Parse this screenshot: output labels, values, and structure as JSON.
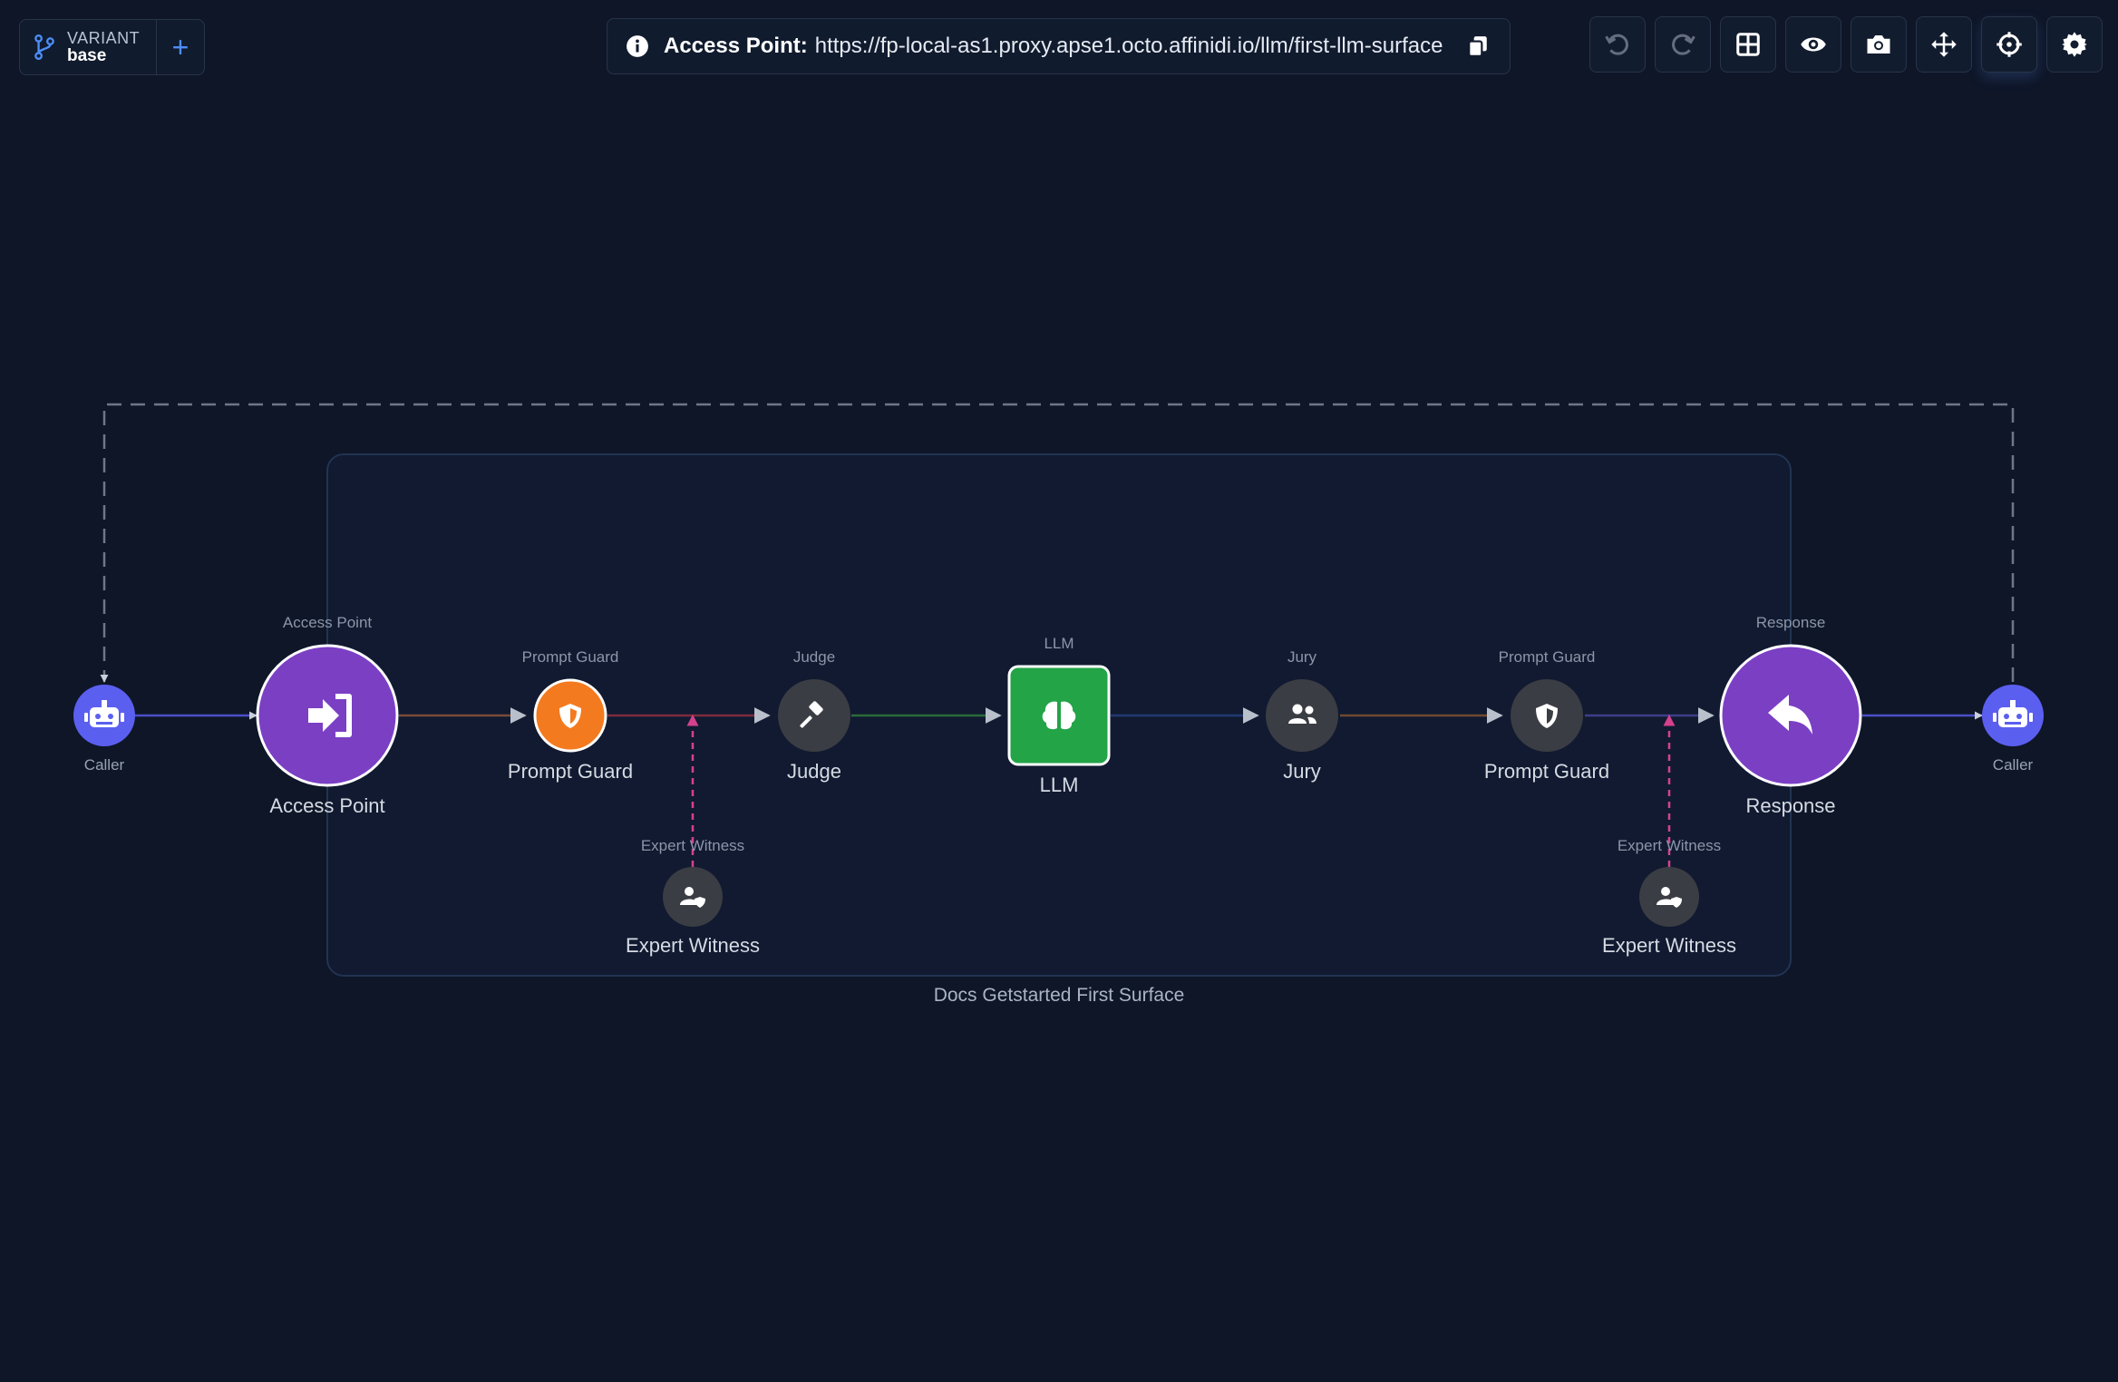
{
  "variant": {
    "label": "VARIANT",
    "value": "base",
    "add": "+"
  },
  "access": {
    "label": "Access Point:",
    "url": "https://fp-local-as1.proxy.apse1.octo.affinidi.io/llm/first-llm-surface"
  },
  "toolbar": [
    {
      "icon": "undo-icon",
      "enabled": false
    },
    {
      "icon": "redo-icon",
      "enabled": false
    },
    {
      "icon": "grid-layout-icon",
      "enabled": true
    },
    {
      "icon": "eye-icon",
      "enabled": true
    },
    {
      "icon": "camera-icon",
      "enabled": true
    },
    {
      "icon": "move-arrows-icon",
      "enabled": true
    },
    {
      "icon": "crosshair-icon",
      "enabled": true
    },
    {
      "icon": "gear-icon",
      "enabled": true
    }
  ],
  "surface": {
    "label": "Docs Getstarted First Surface"
  },
  "callers": {
    "left": "Caller",
    "right": "Caller"
  },
  "nodes": {
    "access_point": {
      "top": "Access Point",
      "label": "Access Point",
      "icon": "sign-in-icon",
      "color": "#7b3fc4"
    },
    "prompt_guard_in": {
      "top": "Prompt Guard",
      "label": "Prompt Guard",
      "icon": "shield-icon",
      "color": "#f47a1f"
    },
    "judge": {
      "top": "Judge",
      "label": "Judge",
      "icon": "gavel-icon",
      "color": "#3b3d44"
    },
    "llm": {
      "top": "LLM",
      "label": "LLM",
      "icon": "brain-icon",
      "color": "#22a447"
    },
    "jury": {
      "top": "Jury",
      "label": "Jury",
      "icon": "users-icon",
      "color": "#3b3d44"
    },
    "prompt_guard_out": {
      "top": "Prompt Guard",
      "label": "Prompt Guard",
      "icon": "shield-icon",
      "color": "#3b3d44"
    },
    "response": {
      "top": "Response",
      "label": "Response",
      "icon": "reply-icon",
      "color": "#7b3fc4"
    },
    "expert_witness_1": {
      "top": "Expert Witness",
      "label": "Expert Witness",
      "icon": "user-shield-icon",
      "color": "#3b3d44"
    },
    "expert_witness_2": {
      "top": "Expert Witness",
      "label": "Expert Witness",
      "icon": "user-shield-icon",
      "color": "#3b3d44"
    }
  },
  "colors": {
    "caller": "#5b5ff0",
    "edge_blue": "#4b4fc7",
    "edge_witness": "#d6418e"
  }
}
